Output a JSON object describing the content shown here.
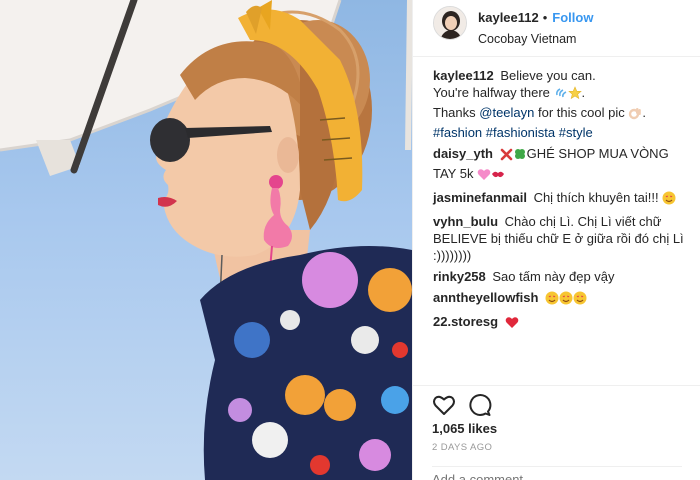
{
  "post": {
    "username": "kaylee112",
    "follow_label": "Follow",
    "separator": "•",
    "location": "Cocobay Vietnam",
    "likes": "1,065 likes",
    "timestamp": "2 DAYS AGO",
    "add_comment_placeholder": "Add a comment..."
  },
  "caption": {
    "author": "kaylee112",
    "line1": "Believe you can.",
    "line2": "You're halfway there",
    "line3_prefix": "Thanks",
    "mention": "@teelayn",
    "line3_suffix": "for this cool pic",
    "hashtags": "#fashion #fashionista #style"
  },
  "comments": [
    {
      "author": "daisy_yth",
      "text": "GHÉ SHOP MUA VÒNG TAY 5k"
    },
    {
      "author": "jasminefanmail",
      "text": "Chị thích khuyên tai!!!"
    },
    {
      "author": "vyhn_bulu",
      "text": "Chào chị Lì. Chị Lì viết chữ BELIEVE bị thiếu chữ E ở giữa rồi đó chị Lì :))))))))"
    },
    {
      "author": "rinky258",
      "text": "Sao tấm này đẹp vậy"
    },
    {
      "author": "anntheyellowfish",
      "text": ""
    },
    {
      "author": "22.storesg",
      "text": ""
    }
  ],
  "colors": {
    "link_blue": "#3897f0",
    "tag_blue": "#003569",
    "sky": "#a8c8ee",
    "bandana": "#f2b134",
    "heart_red": "#ed4956"
  }
}
